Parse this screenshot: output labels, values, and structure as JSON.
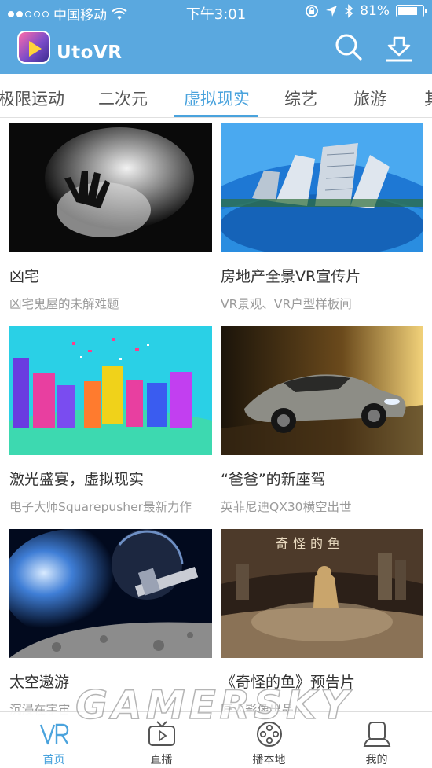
{
  "status_bar": {
    "carrier": "中国移动",
    "time": "下午3:01",
    "battery": "81%",
    "battery_level": 0.81
  },
  "app": {
    "name": "UtoVR",
    "search_icon": "search-icon",
    "download_icon": "download-icon"
  },
  "tabs": [
    {
      "label": "极限运动"
    },
    {
      "label": "二次元"
    },
    {
      "label": "虚拟现实",
      "active": true
    },
    {
      "label": "综艺"
    },
    {
      "label": "旅游"
    },
    {
      "label": "其"
    }
  ],
  "videos": [
    {
      "title": "凶宅",
      "subtitle": "凶宅鬼屋的未解难题"
    },
    {
      "title": "房地产全景VR宣传片",
      "subtitle": "VR景观、VR户型样板间"
    },
    {
      "title": "激光盛宴，虚拟现实",
      "subtitle": "电子大师Squarepusher最新力作"
    },
    {
      "title": "“爸爸”的新座驾",
      "subtitle": "英菲尼迪QX30横空出世"
    },
    {
      "title": "太空遨游",
      "subtitle": "沉浸在宇宙"
    },
    {
      "title": "《奇怪的鱼》预告片",
      "subtitle": "匠人影像出品"
    }
  ],
  "bottom_nav": [
    {
      "label": "首页",
      "icon": "vr-icon",
      "active": true
    },
    {
      "label": "直播",
      "icon": "live-tv-icon"
    },
    {
      "label": "播本地",
      "icon": "film-reel-icon"
    },
    {
      "label": "我的",
      "icon": "profile-icon"
    }
  ],
  "watermark": "GAMERSKY",
  "colors": {
    "header": "#5aa8df",
    "accent": "#4aa3dd",
    "title_text": "#333333",
    "subtitle_text": "#9a9a9a"
  }
}
